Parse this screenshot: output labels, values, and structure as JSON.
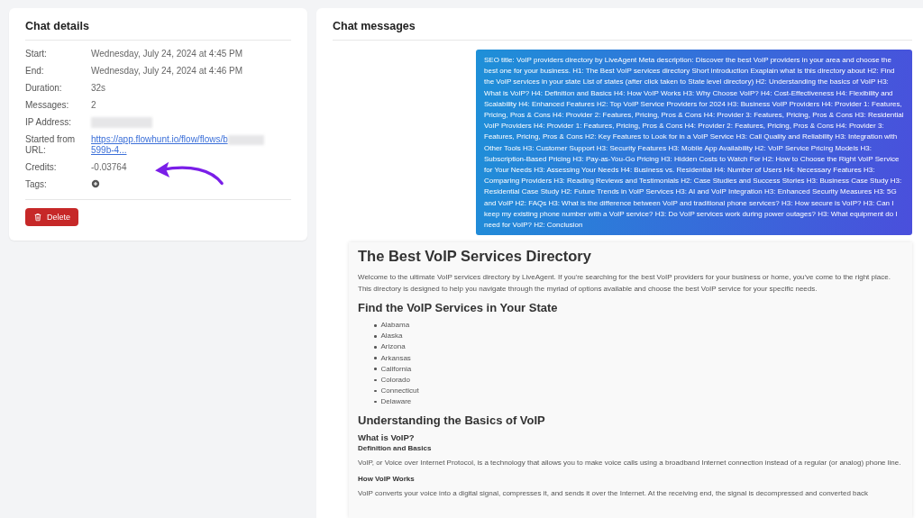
{
  "details": {
    "title": "Chat details",
    "fields": [
      {
        "kind": "text",
        "label": "Start:",
        "value": "Wednesday, July 24, 2024 at 4:45 PM"
      },
      {
        "kind": "text",
        "label": "End:",
        "value": "Wednesday, July 24, 2024 at 4:46 PM"
      },
      {
        "kind": "text",
        "label": "Duration:",
        "value": "32s"
      },
      {
        "kind": "text",
        "label": "Messages:",
        "value": "2"
      },
      {
        "kind": "redacted",
        "label": "IP Address:"
      },
      {
        "kind": "link",
        "label": "Started from URL:",
        "value": "https://app.flowhunt.io/flow/flows/b",
        "value_end": "599b-4..."
      },
      {
        "kind": "text",
        "label": "Credits:",
        "value": "-0.03764"
      },
      {
        "kind": "tags",
        "label": "Tags:"
      }
    ],
    "delete_button": "Delete"
  },
  "messages": {
    "title": "Chat messages",
    "user_message": "SEO title: VoIP providers directory by LiveAgent Meta description: Discover the best VoIP providers in your area and choose the best one for your business. H1: The Best VoIP services directory Short introduction Exaplain what is this directory about H2: Find the VoIP services in your state List of states (after click taken to State level directory) H2: Understanding the basics of VoIP H3: What is VoIP? H4: Definition and Basics H4: How VoIP Works H3: Why Choose VoIP? H4: Cost-Effectiveness H4: Flexibility and Scalability H4: Enhanced Features H2: Top VoIP Service Providers for 2024 H3: Business VoIP Providers H4: Provider 1: Features, Pricing, Pros & Cons H4: Provider 2: Features, Pricing, Pros & Cons H4: Provider 3: Features, Pricing, Pros & Cons H3: Residential VoIP Providers H4: Provider 1: Features, Pricing, Pros & Cons H4: Provider 2: Features, Pricing, Pros & Cons H4: Provider 3: Features, Pricing, Pros & Cons H2: Key Features to Look for in a VoIP Service H3: Call Quality and Reliability H3: Integration with Other Tools H3: Customer Support H3: Security Features H3: Mobile App Availability H2: VoIP Service Pricing Models H3: Subscription-Based Pricing H3: Pay-as-You-Go Pricing H3: Hidden Costs to Watch For H2: How to Choose the Right VoIP Service for Your Needs H3: Assessing Your Needs H4: Business vs. Residential H4: Number of Users H4: Necessary Features H3: Comparing Providers H3: Reading Reviews and Testimonials H2: Case Studies and Success Stories H3: Business Case Study H3: Residential Case Study H2: Future Trends in VoIP Services H3: AI and VoIP Integration H3: Enhanced Security Measures H3: 5G and VoIP H2: FAQs H3: What is the difference between VoIP and traditional phone services? H3: How secure is VoIP? H3: Can I keep my existing phone number with a VoIP service? H3: Do VoIP services work during power outages? H3: What equipment do I need for VoIP? H2: Conclusion",
    "reply": [
      {
        "kind": "h1",
        "text": "The Best VoIP Services Directory"
      },
      {
        "kind": "p",
        "text": "Welcome to the ultimate VoIP services directory by LiveAgent. If you're searching for the best VoIP providers for your business or home, you've come to the right place. This directory is designed to help you navigate through the myriad of options available and choose the best VoIP service for your specific needs."
      },
      {
        "kind": "h2",
        "text": "Find the VoIP Services in Your State"
      },
      {
        "kind": "list",
        "items": [
          "Alabama",
          "Alaska",
          "Arizona",
          "Arkansas",
          "California",
          "Colorado",
          "Connecticut",
          "Delaware"
        ]
      },
      {
        "kind": "h2",
        "text": "Understanding the Basics of VoIP"
      },
      {
        "kind": "h3",
        "text": "What is VoIP?"
      },
      {
        "kind": "h4",
        "text": "Definition and Basics"
      },
      {
        "kind": "p",
        "text": "VoIP, or Voice over Internet Protocol, is a technology that allows you to make voice calls using a broadband Internet connection instead of a regular (or analog) phone line."
      },
      {
        "kind": "h4",
        "text": "How VoIP Works"
      },
      {
        "kind": "p",
        "text": "VoIP converts your voice into a digital signal, compresses it, and sends it over the Internet. At the receiving end, the signal is decompressed and converted back"
      }
    ]
  }
}
